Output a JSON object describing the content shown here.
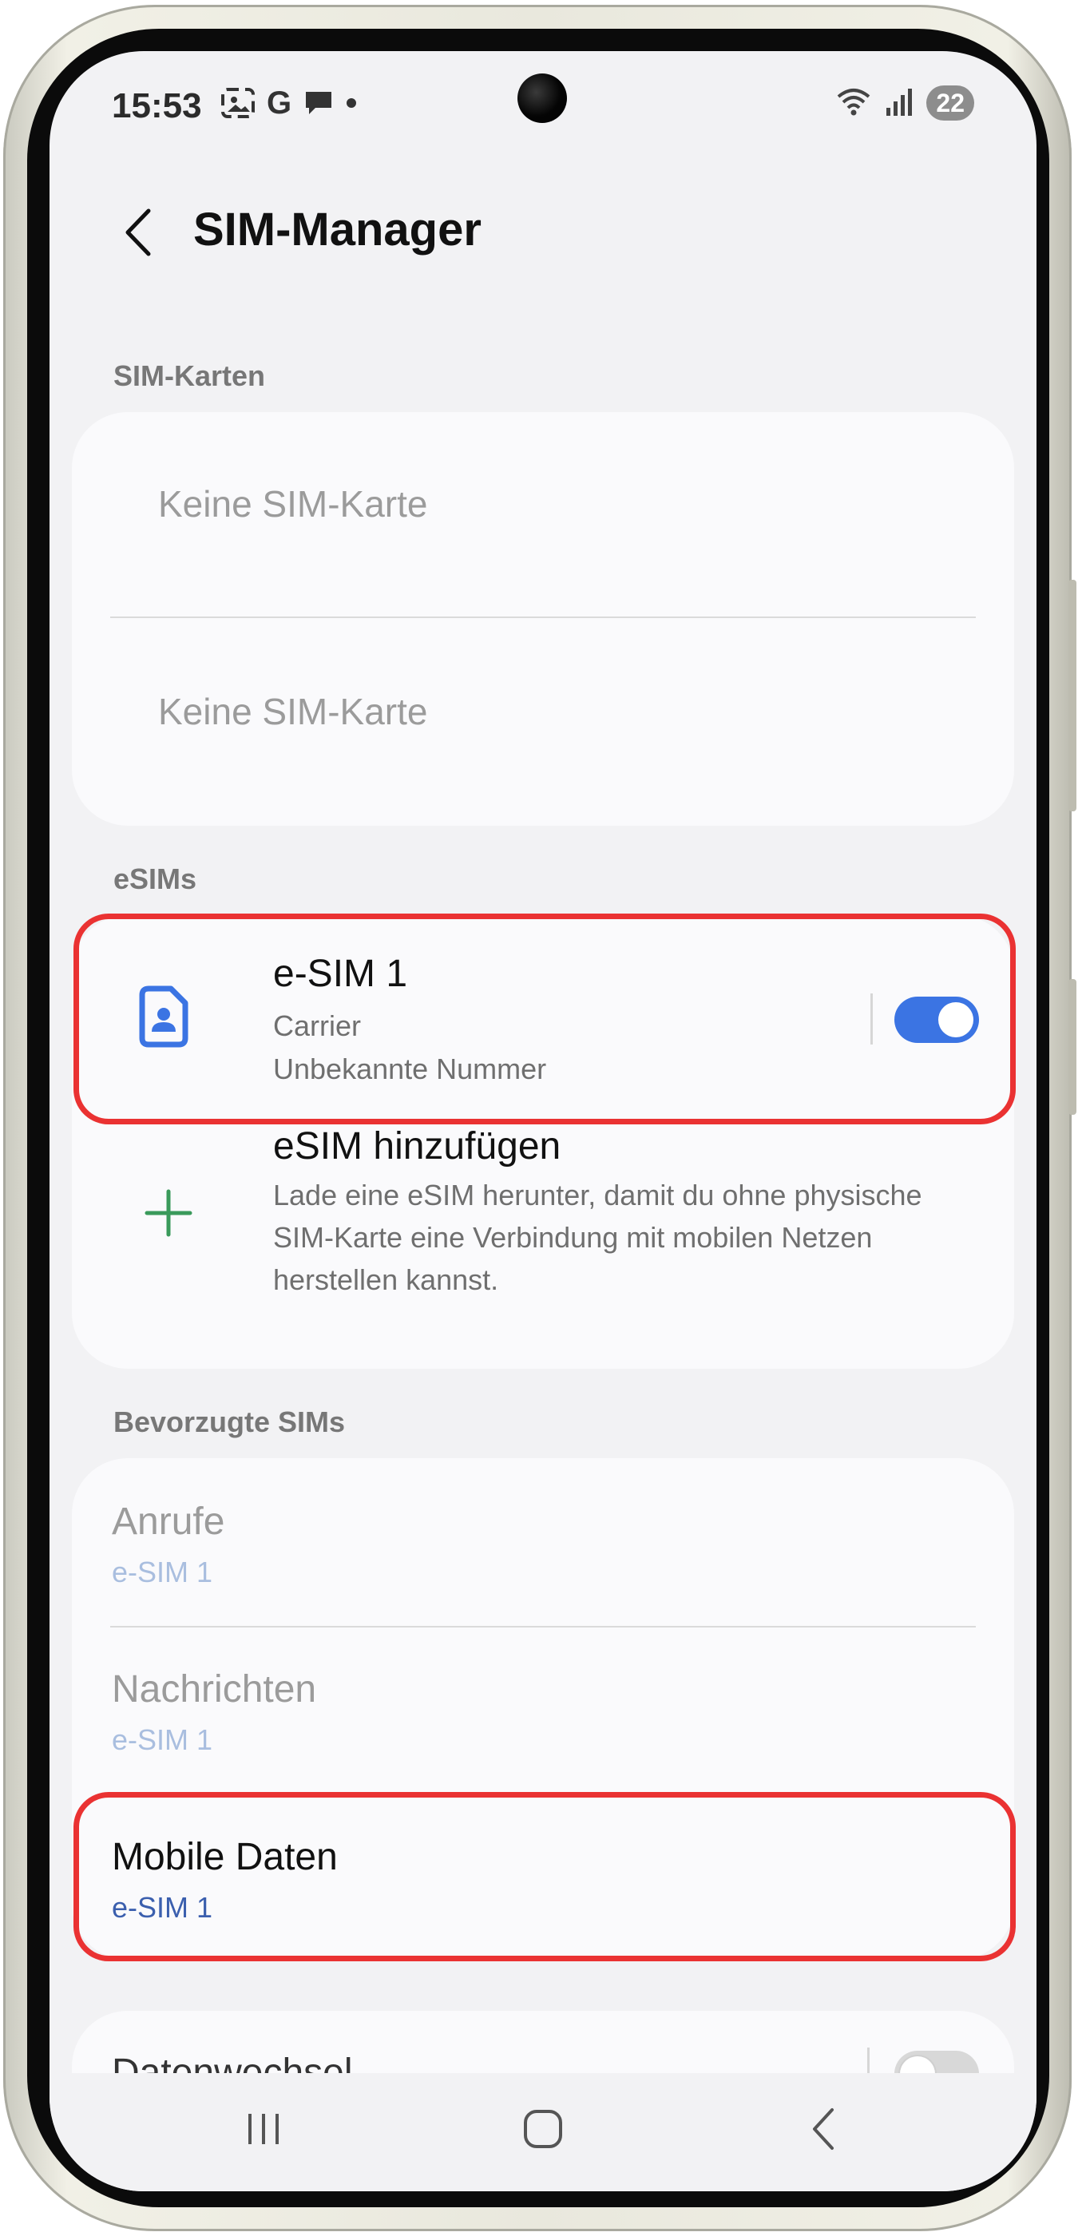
{
  "status_bar": {
    "time": "15:53",
    "left_icons": [
      "screenshot-icon",
      "google-icon",
      "chat-icon",
      "dot-icon"
    ],
    "google_glyph": "G",
    "battery_level": "22",
    "right_icons": [
      "wifi-icon",
      "signal-icon",
      "battery-icon"
    ]
  },
  "header": {
    "title": "SIM-Manager",
    "back_icon": "chevron-left-icon"
  },
  "sim_cards": {
    "label": "SIM-Karten",
    "items": [
      "Keine SIM-Karte",
      "Keine SIM-Karte"
    ]
  },
  "esims": {
    "label": "eSIMs",
    "esim1": {
      "title": "e-SIM 1",
      "carrier": "Carrier",
      "number": "Unbekannte Nummer",
      "enabled": true,
      "icon": "sim-card-icon",
      "toggle_color": "#3b74e3"
    },
    "add": {
      "title": "eSIM hinzufügen",
      "description": "Lade eine eSIM herunter, damit du ohne physische SIM-Karte eine Verbindung mit mobilen Netzen herstellen kannst.",
      "icon": "plus-icon",
      "icon_color": "#3a9a5b"
    }
  },
  "preferred_sims": {
    "label": "Bevorzugte SIMs",
    "items": [
      {
        "title": "Anrufe",
        "value": "e-SIM 1",
        "active": false
      },
      {
        "title": "Nachrichten",
        "value": "e-SIM 1",
        "active": false
      },
      {
        "title": "Mobile Daten",
        "value": "e-SIM 1",
        "active": true
      }
    ]
  },
  "data_switch": {
    "title": "Datenwechsel",
    "enabled": false
  },
  "highlight_color": "#ea3232",
  "navbar": {
    "icons": [
      "recent-apps-icon",
      "home-icon",
      "back-icon"
    ]
  }
}
